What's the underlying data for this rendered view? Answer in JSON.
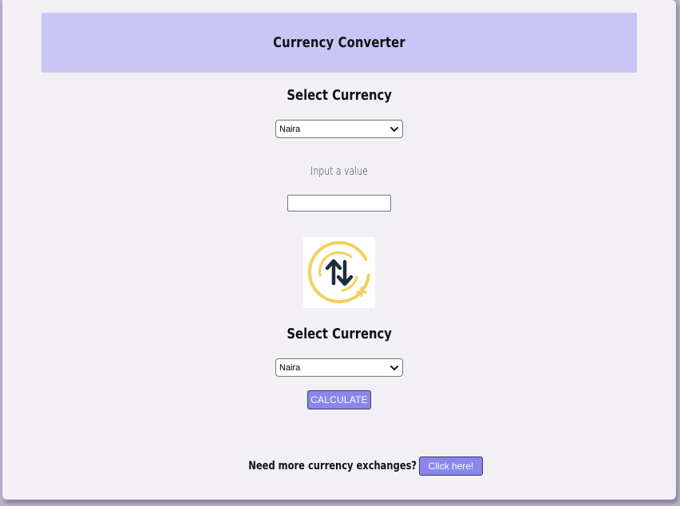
{
  "app": {
    "title": "Currency Converter"
  },
  "from": {
    "heading": "Select Currency",
    "selected": "Naira"
  },
  "amount": {
    "label": "Input a value",
    "value": "",
    "placeholder": ""
  },
  "swap": {
    "icon": "swap-arrows-icon"
  },
  "to": {
    "heading": "Select Currency",
    "selected": "Naira"
  },
  "actions": {
    "calculate_label": "CALCULATE"
  },
  "footer": {
    "prompt": "Need more currency exchanges?",
    "button_label": "Click here!"
  },
  "colors": {
    "header_bg": "#c9c6f5",
    "button_bg": "#8a86ec",
    "icon_ring": "#f5cf5a",
    "icon_arrows": "#1f2d3d"
  }
}
